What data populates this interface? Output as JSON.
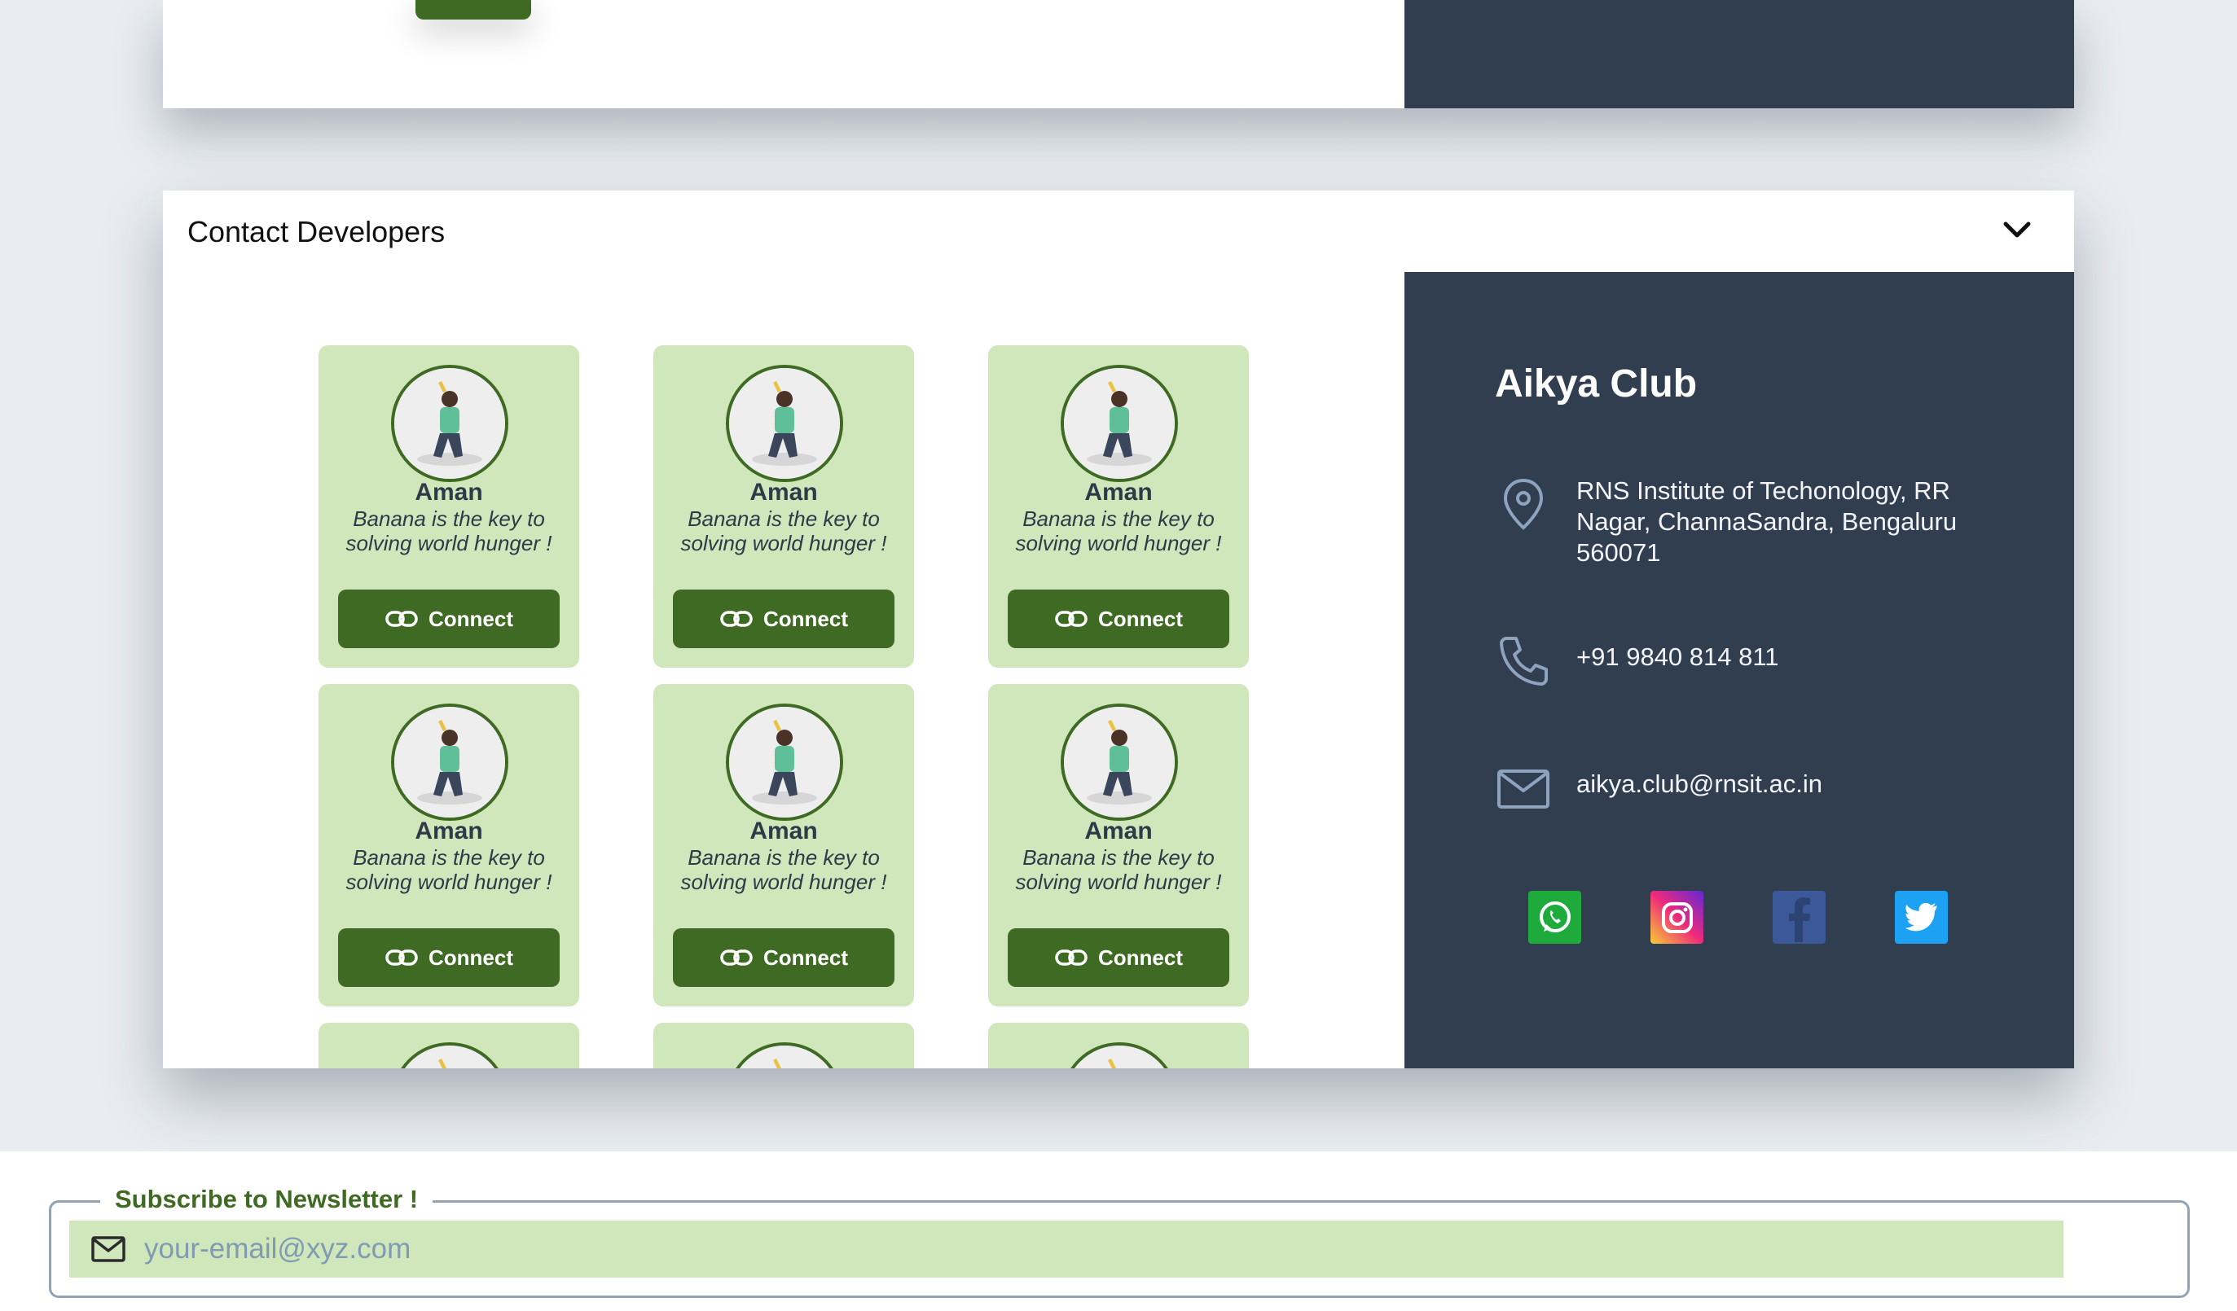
{
  "contact_section": {
    "title": "Contact Developers"
  },
  "developers": [
    {
      "name": "Aman",
      "quote": "Banana is the key to solving world hunger !",
      "button": "Connect"
    },
    {
      "name": "Aman",
      "quote": "Banana is the key to solving world hunger !",
      "button": "Connect"
    },
    {
      "name": "Aman",
      "quote": "Banana is the key to solving world hunger !",
      "button": "Connect"
    },
    {
      "name": "Aman",
      "quote": "Banana is the key to solving world hunger !",
      "button": "Connect"
    },
    {
      "name": "Aman",
      "quote": "Banana is the key to solving world hunger !",
      "button": "Connect"
    },
    {
      "name": "Aman",
      "quote": "Banana is the key to solving world hunger !",
      "button": "Connect"
    }
  ],
  "club": {
    "name": "Aikya Club",
    "address": "RNS Institute of Techonology, RR Nagar, ChannaSandra, Bengaluru 560071",
    "phone": "+91 9840 814 811",
    "email": "aikya.club@rnsit.ac.in",
    "socials": [
      {
        "icon": "whatsapp-icon",
        "color": "#1faa3c"
      },
      {
        "icon": "instagram-icon",
        "color": "#e1306c"
      },
      {
        "icon": "facebook-icon",
        "color": "#3b5998"
      },
      {
        "icon": "twitter-icon",
        "color": "#1da1f2"
      }
    ]
  },
  "newsletter": {
    "legend": "Subscribe to Newsletter !",
    "placeholder": "your-email@xyz.com"
  },
  "colors": {
    "accent_green": "#3e6a23",
    "card_green": "#d0e6bb",
    "dark_panel": "#313e50"
  }
}
